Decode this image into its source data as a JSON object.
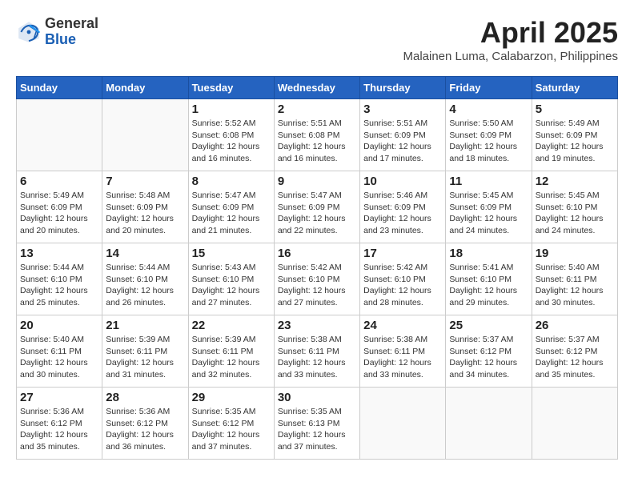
{
  "header": {
    "logo_general": "General",
    "logo_blue": "Blue",
    "title": "April 2025",
    "location": "Malainen Luma, Calabarzon, Philippines"
  },
  "days_of_week": [
    "Sunday",
    "Monday",
    "Tuesday",
    "Wednesday",
    "Thursday",
    "Friday",
    "Saturday"
  ],
  "weeks": [
    [
      {
        "day": "",
        "info": ""
      },
      {
        "day": "",
        "info": ""
      },
      {
        "day": "1",
        "info": "Sunrise: 5:52 AM\nSunset: 6:08 PM\nDaylight: 12 hours and 16 minutes."
      },
      {
        "day": "2",
        "info": "Sunrise: 5:51 AM\nSunset: 6:08 PM\nDaylight: 12 hours and 16 minutes."
      },
      {
        "day": "3",
        "info": "Sunrise: 5:51 AM\nSunset: 6:09 PM\nDaylight: 12 hours and 17 minutes."
      },
      {
        "day": "4",
        "info": "Sunrise: 5:50 AM\nSunset: 6:09 PM\nDaylight: 12 hours and 18 minutes."
      },
      {
        "day": "5",
        "info": "Sunrise: 5:49 AM\nSunset: 6:09 PM\nDaylight: 12 hours and 19 minutes."
      }
    ],
    [
      {
        "day": "6",
        "info": "Sunrise: 5:49 AM\nSunset: 6:09 PM\nDaylight: 12 hours and 20 minutes."
      },
      {
        "day": "7",
        "info": "Sunrise: 5:48 AM\nSunset: 6:09 PM\nDaylight: 12 hours and 20 minutes."
      },
      {
        "day": "8",
        "info": "Sunrise: 5:47 AM\nSunset: 6:09 PM\nDaylight: 12 hours and 21 minutes."
      },
      {
        "day": "9",
        "info": "Sunrise: 5:47 AM\nSunset: 6:09 PM\nDaylight: 12 hours and 22 minutes."
      },
      {
        "day": "10",
        "info": "Sunrise: 5:46 AM\nSunset: 6:09 PM\nDaylight: 12 hours and 23 minutes."
      },
      {
        "day": "11",
        "info": "Sunrise: 5:45 AM\nSunset: 6:09 PM\nDaylight: 12 hours and 24 minutes."
      },
      {
        "day": "12",
        "info": "Sunrise: 5:45 AM\nSunset: 6:10 PM\nDaylight: 12 hours and 24 minutes."
      }
    ],
    [
      {
        "day": "13",
        "info": "Sunrise: 5:44 AM\nSunset: 6:10 PM\nDaylight: 12 hours and 25 minutes."
      },
      {
        "day": "14",
        "info": "Sunrise: 5:44 AM\nSunset: 6:10 PM\nDaylight: 12 hours and 26 minutes."
      },
      {
        "day": "15",
        "info": "Sunrise: 5:43 AM\nSunset: 6:10 PM\nDaylight: 12 hours and 27 minutes."
      },
      {
        "day": "16",
        "info": "Sunrise: 5:42 AM\nSunset: 6:10 PM\nDaylight: 12 hours and 27 minutes."
      },
      {
        "day": "17",
        "info": "Sunrise: 5:42 AM\nSunset: 6:10 PM\nDaylight: 12 hours and 28 minutes."
      },
      {
        "day": "18",
        "info": "Sunrise: 5:41 AM\nSunset: 6:10 PM\nDaylight: 12 hours and 29 minutes."
      },
      {
        "day": "19",
        "info": "Sunrise: 5:40 AM\nSunset: 6:11 PM\nDaylight: 12 hours and 30 minutes."
      }
    ],
    [
      {
        "day": "20",
        "info": "Sunrise: 5:40 AM\nSunset: 6:11 PM\nDaylight: 12 hours and 30 minutes."
      },
      {
        "day": "21",
        "info": "Sunrise: 5:39 AM\nSunset: 6:11 PM\nDaylight: 12 hours and 31 minutes."
      },
      {
        "day": "22",
        "info": "Sunrise: 5:39 AM\nSunset: 6:11 PM\nDaylight: 12 hours and 32 minutes."
      },
      {
        "day": "23",
        "info": "Sunrise: 5:38 AM\nSunset: 6:11 PM\nDaylight: 12 hours and 33 minutes."
      },
      {
        "day": "24",
        "info": "Sunrise: 5:38 AM\nSunset: 6:11 PM\nDaylight: 12 hours and 33 minutes."
      },
      {
        "day": "25",
        "info": "Sunrise: 5:37 AM\nSunset: 6:12 PM\nDaylight: 12 hours and 34 minutes."
      },
      {
        "day": "26",
        "info": "Sunrise: 5:37 AM\nSunset: 6:12 PM\nDaylight: 12 hours and 35 minutes."
      }
    ],
    [
      {
        "day": "27",
        "info": "Sunrise: 5:36 AM\nSunset: 6:12 PM\nDaylight: 12 hours and 35 minutes."
      },
      {
        "day": "28",
        "info": "Sunrise: 5:36 AM\nSunset: 6:12 PM\nDaylight: 12 hours and 36 minutes."
      },
      {
        "day": "29",
        "info": "Sunrise: 5:35 AM\nSunset: 6:12 PM\nDaylight: 12 hours and 37 minutes."
      },
      {
        "day": "30",
        "info": "Sunrise: 5:35 AM\nSunset: 6:13 PM\nDaylight: 12 hours and 37 minutes."
      },
      {
        "day": "",
        "info": ""
      },
      {
        "day": "",
        "info": ""
      },
      {
        "day": "",
        "info": ""
      }
    ]
  ]
}
